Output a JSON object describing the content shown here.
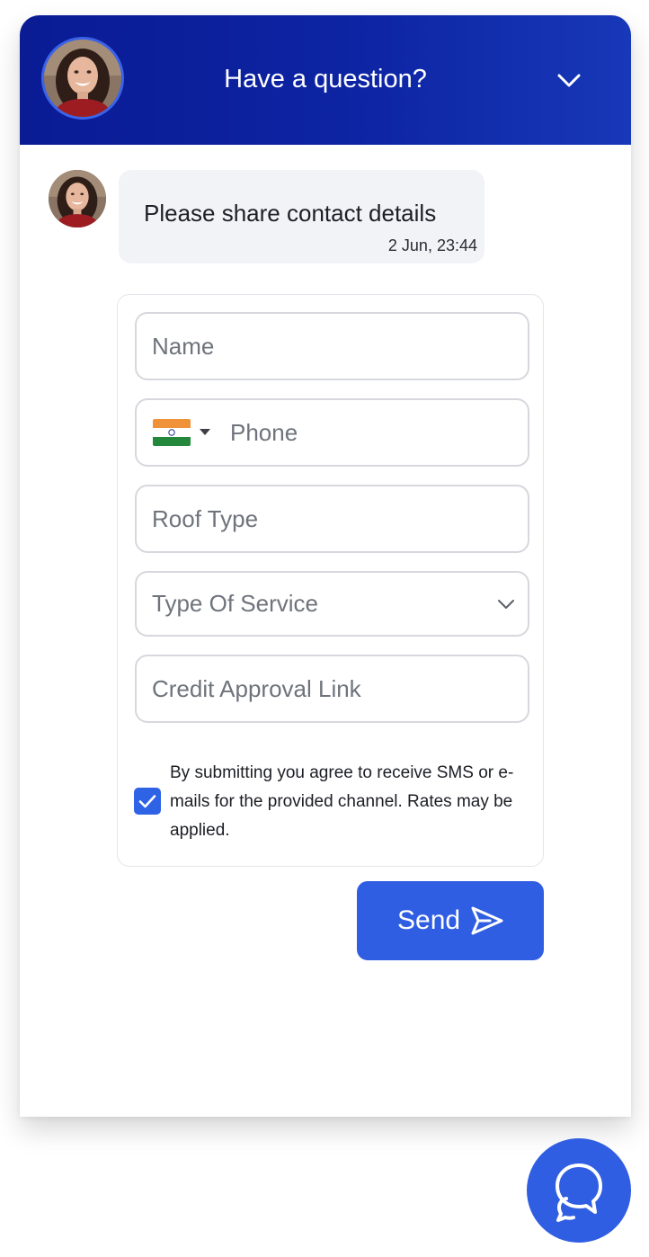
{
  "header": {
    "title": "Have a question?",
    "avatar_icon": "agent-avatar",
    "collapse_icon": "chevron-down-icon"
  },
  "message": {
    "text": "Please share contact details",
    "time": "2 Jun, 23:44"
  },
  "form": {
    "name_placeholder": "Name",
    "phone_country_icon": "india-flag-icon",
    "phone_placeholder": "Phone",
    "roof_type_placeholder": "Roof Type",
    "service_placeholder": "Type Of Service",
    "credit_link_placeholder": "Credit Approval Link",
    "consent_checked": true,
    "consent_text": "By submitting you agree to receive SMS or e-mails for the provided channel. Rates may be applied."
  },
  "send_button": {
    "label": "Send",
    "icon": "paper-plane-icon"
  },
  "launcher": {
    "icon": "chat-bubbles-icon"
  },
  "colors": {
    "header_start": "#0a1b94",
    "header_end": "#1738b8",
    "accent": "#2f5ee3",
    "bubble_bg": "#f2f3f7"
  }
}
